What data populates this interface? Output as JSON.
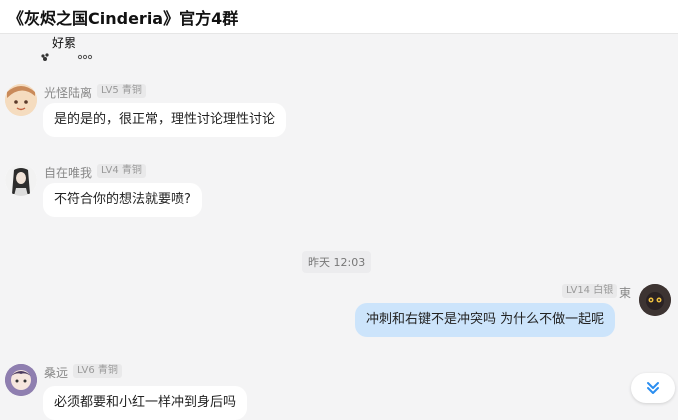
{
  "header": {
    "title": "《灰烬之国Cinderia》官方4群"
  },
  "top_sticker": {
    "text": "好累"
  },
  "timestamp": "昨天 12:03",
  "messages": [
    {
      "name": "光怪陆离",
      "badge": "LV5 青铜",
      "text": "是的是的，很正常，理性讨论理性讨论"
    },
    {
      "name": "自在唯我",
      "badge": "LV4 青铜",
      "text": "不符合你的想法就要喷?"
    },
    {
      "name": "東",
      "badge": "LV14 白银",
      "text": "冲刺和右键不是冲突吗 为什么不做一起呢"
    },
    {
      "name": "桑远",
      "badge": "LV6 青铜",
      "text": "必须都要和小红一样冲到身后吗"
    }
  ],
  "colors": {
    "self_bubble": "#cce4fb",
    "other_bubble": "#ffffff",
    "accent": "#2b8ef0"
  },
  "icons": {
    "scroll_down": "double-chevron-down-icon"
  }
}
